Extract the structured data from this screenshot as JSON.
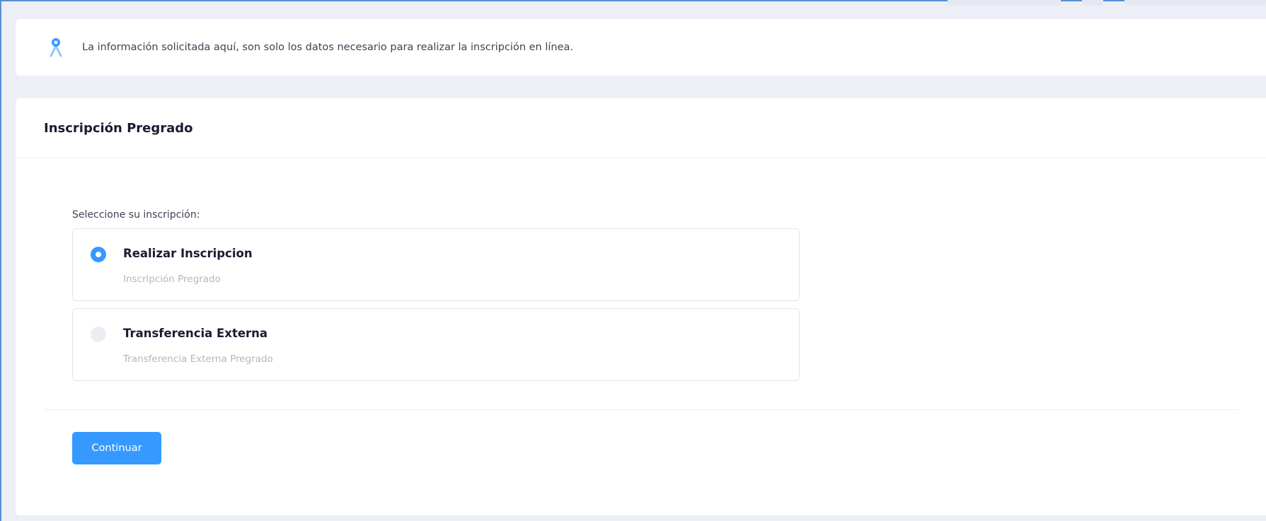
{
  "notice": {
    "icon": "location-pin-icon",
    "text": "La información solicitada aquí, son solo los datos necesario para realizar la inscripción en línea."
  },
  "card": {
    "title": "Inscripción Pregrado",
    "prompt": "Seleccione su inscripción:",
    "options": [
      {
        "title": "Realizar Inscripcion",
        "subtitle": "Inscripción Pregrado",
        "selected": true
      },
      {
        "title": "Transferencia Externa",
        "subtitle": "Transferencia Externa Pregrado",
        "selected": false
      }
    ],
    "continue_label": "Continuar"
  },
  "colors": {
    "accent": "#3699ff",
    "background": "#edeff7",
    "card": "#ffffff",
    "muted_text": "#b5b5c3"
  }
}
